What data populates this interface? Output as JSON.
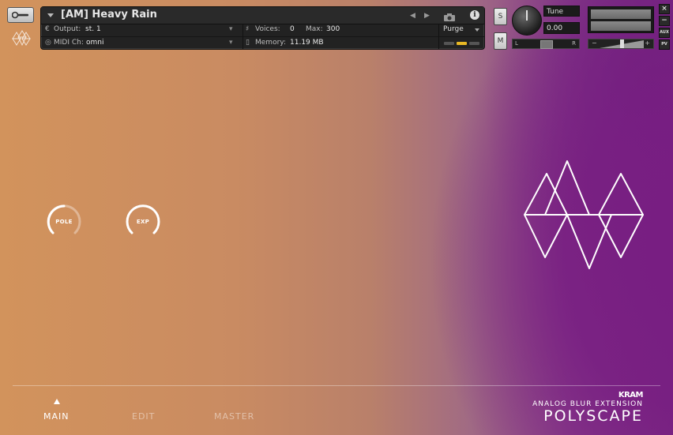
{
  "header": {
    "instrument_title": "[AM] Heavy Rain",
    "nav_prev": "◀",
    "nav_next": "▶",
    "info_label": "i",
    "output_label": "Output:",
    "output_value": "st. 1",
    "voices_label": "Voices:",
    "voices_value": "0",
    "max_label": "Max:",
    "max_value": "300",
    "midi_label": "MIDI Ch:",
    "midi_value": "omni",
    "memory_label": "Memory:",
    "memory_value": "11.19 MB",
    "purge_label": "Purge",
    "solo_label": "S",
    "mute_label": "M",
    "tune_label": "Tune",
    "tune_value": "0.00",
    "pan_left": "L",
    "pan_right": "R",
    "vol_minus": "−",
    "vol_plus": "+",
    "side": {
      "close": "×",
      "minimize": "−",
      "aux": "AUX",
      "pv": "PV"
    }
  },
  "controls": {
    "pole_label": "POLE",
    "exp_label": "EXP"
  },
  "tabs": [
    {
      "label": "MAIN",
      "active": true
    },
    {
      "label": "EDIT",
      "active": false
    },
    {
      "label": "MASTER",
      "active": false
    }
  ],
  "brand": {
    "maker": "KRAM",
    "subtitle": "ANALOG BLUR EXTENSION",
    "product": "POLYSCAPE"
  },
  "colors": {
    "accent_led": "#e8b825",
    "bg_warm": "#d2935c",
    "bg_purple": "#7a2a83"
  }
}
